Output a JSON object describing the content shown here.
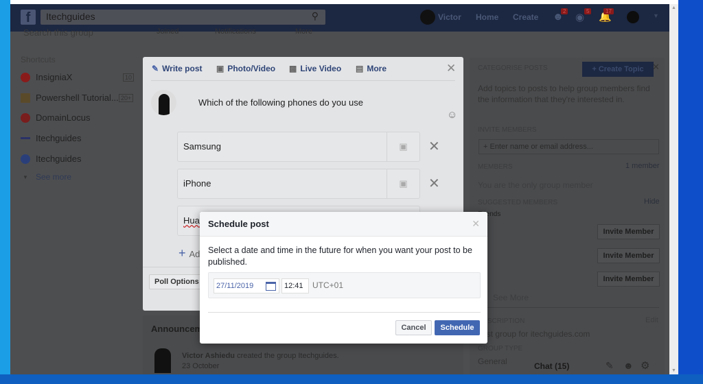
{
  "header": {
    "search_value": "Itechguides",
    "user": "Victor",
    "home": "Home",
    "create": "Create",
    "friend_badge": "2",
    "message_badge": "5",
    "notif_badge": "17"
  },
  "group_bar": {
    "search_placeholder": "Search this group",
    "joined": "Joined",
    "notifications": "Notifications",
    "more": "More"
  },
  "sidebar": {
    "heading": "Shortcuts",
    "items": [
      {
        "label": "InsigniaX",
        "count": "10",
        "color": "#8a1b1b"
      },
      {
        "label": "Powershell Tutorial...",
        "count": "20+",
        "color": "#5a4a2a"
      },
      {
        "label": "DomainLocus",
        "color": "#7a1d1d"
      },
      {
        "label": "Itechguides",
        "color": "#2a3266"
      },
      {
        "label": "Itechguides",
        "color": "#2a3f7a"
      }
    ],
    "see_more": "See more"
  },
  "composer": {
    "tabs": [
      "Write post",
      "Photo/Video",
      "Live Video",
      "More"
    ],
    "question": "Which of the following phones do you use",
    "options": [
      "Samsung",
      "iPhone",
      "Huawei"
    ],
    "add_option": "Add an option...",
    "poll_options": "Poll Options"
  },
  "feed": {
    "announcements": "Announcements",
    "post_author": "Victor Ashiedu",
    "post_text": "created the group Itechguides.",
    "post_date": "23 October"
  },
  "right": {
    "categorise": "Categorise posts",
    "create_topic": "+ Create Topic",
    "categorise_text": "Add topics to posts to help group members find the information that they're interested in.",
    "invite_members": "Invite members",
    "invite_placeholder": "+ Enter name or email address...",
    "members": "Members",
    "member_count": "1 member",
    "only_member": "You are the only group member",
    "suggested": "Suggested members",
    "hide": "Hide",
    "friends": "Friends",
    "invite_btn": "Invite Member",
    "see_more": "See More",
    "description": "Description",
    "edit": "Edit",
    "description_text": "Test group for itechguides.com",
    "group_type": "Group type",
    "group_type_value": "General",
    "chat": "Chat (15)"
  },
  "dialog": {
    "title": "Schedule post",
    "text": "Select a date and time in the future for when you want your post to be published.",
    "date": "27/11/2019",
    "time": "12:41",
    "timezone": "UTC+01",
    "cancel": "Cancel",
    "schedule": "Schedule",
    "accent": "#4267b2"
  }
}
